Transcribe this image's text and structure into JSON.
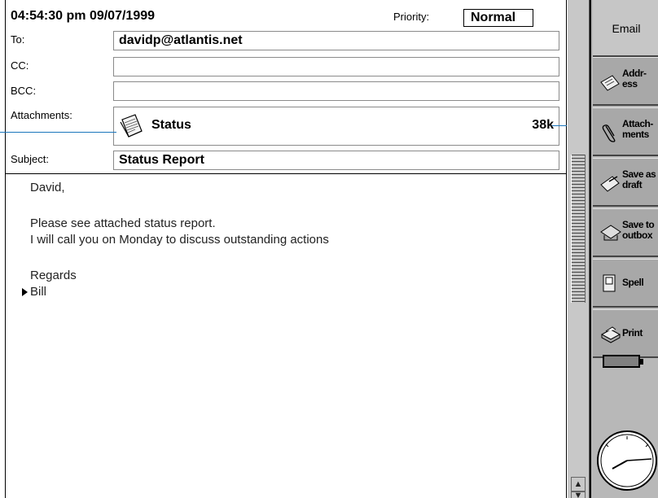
{
  "header": {
    "datetime": "04:54:30 pm 09/07/1999",
    "priority_label": "Priority:",
    "priority_value": "Normal"
  },
  "fields": {
    "to_label": "To:",
    "to_value": "davidp@atlantis.net",
    "cc_label": "CC:",
    "cc_value": "",
    "bcc_label": "BCC:",
    "bcc_value": "",
    "attachments_label": "Attachments:",
    "attachment_name": "Status",
    "attachment_size": "38k",
    "subject_label": "Subject:",
    "subject_value": "Status Report"
  },
  "body": {
    "lines": [
      "David,",
      "",
      "Please see attached status report.",
      "I will call you on Monday to discuss outstanding actions",
      "",
      "Regards",
      "Bill"
    ]
  },
  "commands": {
    "title": "Email",
    "items": [
      {
        "label": "Addr-\ness",
        "icon": "address-book-icon"
      },
      {
        "label": "Attach-\nments",
        "icon": "paperclip-icon"
      },
      {
        "label": "Save as\ndraft",
        "icon": "save-draft-icon"
      },
      {
        "label": "Save to\noutbox",
        "icon": "outbox-icon"
      },
      {
        "label": "Spell",
        "icon": "spell-check-icon"
      },
      {
        "label": "Print",
        "icon": "printer-icon"
      }
    ]
  },
  "colors": {
    "connector": "#1a75bc",
    "command_bar": "#b8b8b8"
  }
}
